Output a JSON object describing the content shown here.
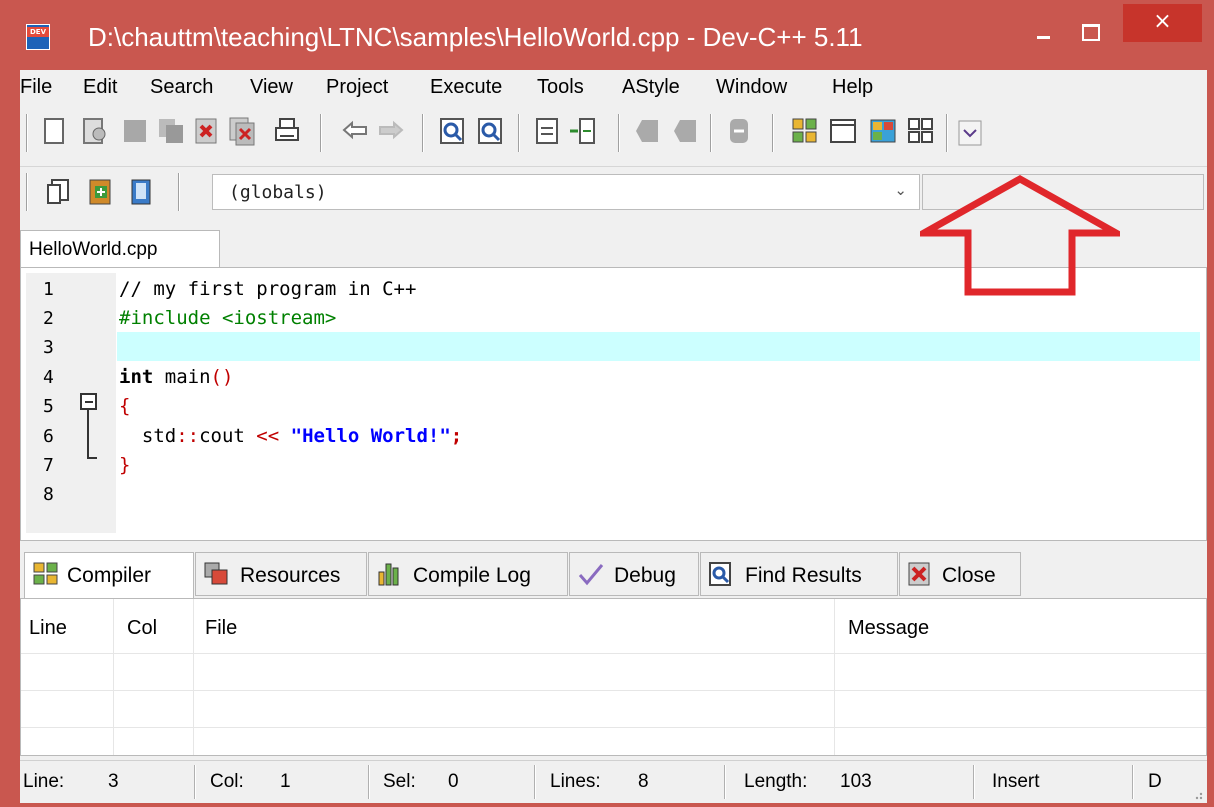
{
  "window": {
    "title": "D:\\chauttm\\teaching\\LTNC\\samples\\HelloWorld.cpp - Dev-C++ 5.11",
    "app_icon_text": "DEV",
    "close_glyph": "×"
  },
  "menu": [
    "File",
    "Edit",
    "Search",
    "View",
    "Project",
    "Execute",
    "Tools",
    "AStyle",
    "Window",
    "Help"
  ],
  "toolbar_main": {
    "icons": [
      "new-file-icon",
      "open-file-icon",
      "save-icon",
      "save-all-icon",
      "close-file-icon",
      "close-all-icon",
      "print-icon",
      "undo-icon",
      "redo-icon",
      "find-icon",
      "replace-icon",
      "indent-icon",
      "unindent-icon",
      "toggle-bookmark-icon",
      "goto-bookmark-icon",
      "compile-disabled-icon",
      "new-project-icon",
      "project-window-icon",
      "insert-icon",
      "toggle-panes-icon",
      "more-icon"
    ]
  },
  "toolbar_second": {
    "icons": [
      "goto-line-icon",
      "add-to-project-icon",
      "project-options-icon"
    ],
    "class_selector": "(globals)",
    "dropdown_glyph": "⌄"
  },
  "editor_tab": {
    "label": "HelloWorld.cpp"
  },
  "editor": {
    "line_numbers": [
      "1",
      "2",
      "3",
      "4",
      "5",
      "6",
      "7",
      "8"
    ],
    "lines": {
      "l1": "// my first program in C++",
      "l2": "#include <iostream>",
      "l4_kw": "int",
      "l4_rest": " main",
      "l4_paren": "()",
      "l5": "{",
      "l6_a": "  std",
      "l6_b": "::",
      "l6_c": "cout ",
      "l6_op": "<<",
      "l6_str": " \"Hello World!\"",
      "l6_semi": ";",
      "l7": "}"
    },
    "colors": {
      "comment": "#000000",
      "preprocessor": "#008000",
      "keyword": "#000000",
      "string": "#0000ff",
      "symbol": "#c00000",
      "current_line": "#ccffff"
    }
  },
  "bottom_tabs": [
    {
      "label": "Compiler",
      "icon": "compiler-grid-icon"
    },
    {
      "label": "Resources",
      "icon": "resources-icon"
    },
    {
      "label": "Compile Log",
      "icon": "bar-chart-icon"
    },
    {
      "label": "Debug",
      "icon": "checkmark-icon"
    },
    {
      "label": "Find Results",
      "icon": "find-results-icon"
    },
    {
      "label": "Close",
      "icon": "close-panel-icon"
    }
  ],
  "grid": {
    "columns": [
      "Line",
      "Col",
      "File",
      "Message"
    ]
  },
  "status": {
    "line_label": "Line:",
    "line_value": "3",
    "col_label": "Col:",
    "col_value": "1",
    "sel_label": "Sel:",
    "sel_value": "0",
    "lines_label": "Lines:",
    "lines_value": "8",
    "length_label": "Length:",
    "length_value": "103",
    "mode": "Insert",
    "extra": "D"
  },
  "annotation": {
    "arrow_color": "#e0272b"
  }
}
